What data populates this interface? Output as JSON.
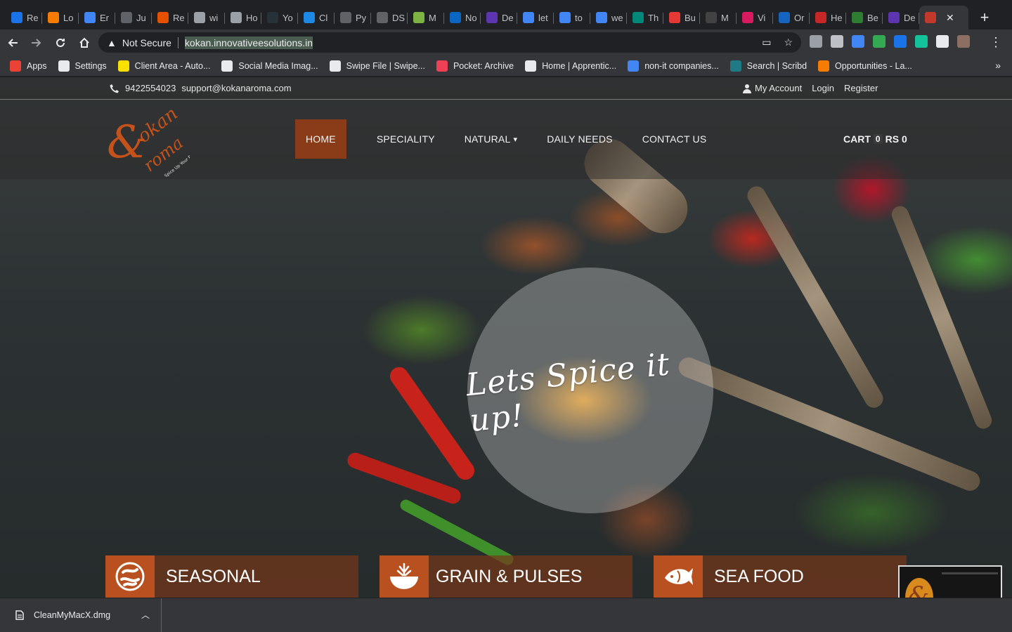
{
  "browser": {
    "tabs": [
      {
        "title": "Re",
        "color": "#1a73e8"
      },
      {
        "title": "Lo",
        "color": "#f57c00"
      },
      {
        "title": "Er",
        "color": "#4285f4"
      },
      {
        "title": "Ju",
        "color": "#5f6368"
      },
      {
        "title": "Re",
        "color": "#e65100"
      },
      {
        "title": "wi",
        "color": "#9aa0a6"
      },
      {
        "title": "Ho",
        "color": "#9aa0a6"
      },
      {
        "title": "Yo",
        "color": "#263238"
      },
      {
        "title": "Cl",
        "color": "#1e88e5"
      },
      {
        "title": "Py",
        "color": "#5f6368"
      },
      {
        "title": "DS",
        "color": "#5f6368"
      },
      {
        "title": "M",
        "color": "#7cb342"
      },
      {
        "title": "No",
        "color": "#0a66c2"
      },
      {
        "title": "De",
        "color": "#5e35b1"
      },
      {
        "title": "let",
        "color": "#4285f4"
      },
      {
        "title": "to",
        "color": "#4285f4"
      },
      {
        "title": "we",
        "color": "#4285f4"
      },
      {
        "title": "Th",
        "color": "#00897b"
      },
      {
        "title": "Bu",
        "color": "#e53935"
      },
      {
        "title": "M",
        "color": "#424242"
      },
      {
        "title": "Vi",
        "color": "#d81b60"
      },
      {
        "title": "Or",
        "color": "#1565c0"
      },
      {
        "title": "He",
        "color": "#c62828"
      },
      {
        "title": "Be",
        "color": "#2e7d32"
      },
      {
        "title": "De",
        "color": "#5e35b1"
      }
    ],
    "active_tab": {
      "title": "",
      "color": "#c0392b"
    },
    "close_glyph": "✕",
    "new_tab_glyph": "+",
    "security_label": "Not Secure",
    "url": "kokan.innovativeesolutions.in",
    "extension_colors": [
      "#9aa0a6",
      "#bdc1c6",
      "#4285f4",
      "#34a853",
      "#1a73e8",
      "#15c39a",
      "#e8eaed",
      "#8d6e63"
    ],
    "bookmarks": [
      {
        "label": "Apps",
        "icon": "apps-grid-icon",
        "color": "#ea4335"
      },
      {
        "label": "Settings",
        "icon": "gear-icon",
        "color": "#e8eaed"
      },
      {
        "label": "Client Area - Auto...",
        "icon": "w-icon",
        "color": "#f9e000"
      },
      {
        "label": "Social Media Imag...",
        "icon": "l-icon",
        "color": "#e8eaed"
      },
      {
        "label": "Swipe File | Swipe...",
        "icon": "globe-icon",
        "color": "#e8eaed"
      },
      {
        "label": "Pocket: Archive",
        "icon": "pocket-icon",
        "color": "#ef4056"
      },
      {
        "label": "Home | Apprentic...",
        "icon": "globe-icon",
        "color": "#e8eaed"
      },
      {
        "label": "non-it companies...",
        "icon": "drive-icon",
        "color": "#4285f4"
      },
      {
        "label": "Search | Scribd",
        "icon": "scribd-icon",
        "color": "#1e7b85"
      },
      {
        "label": "Opportunities - La...",
        "icon": "circle-icon",
        "color": "#f57c00"
      }
    ],
    "bookmarks_more": "»"
  },
  "site": {
    "phone": "9422554023",
    "email": "support@kokanaroma.com",
    "account_links": [
      "My Account",
      "Login",
      "Register"
    ],
    "logo_colors": {
      "primary": "#c4521a"
    },
    "nav": [
      {
        "label": "HOME",
        "active": true
      },
      {
        "label": "SPECIALITY",
        "active": false
      },
      {
        "label": "NATURAL",
        "active": false,
        "dropdown": true
      },
      {
        "label": "DAILY NEEDS",
        "active": false
      },
      {
        "label": "CONTACT US",
        "active": false
      }
    ],
    "cart": {
      "label": "CART",
      "count": "0",
      "currency": "RS",
      "total": "0"
    },
    "hero_text": "Lets Spice it up!",
    "categories": [
      {
        "label": "SEASONAL",
        "icon": "seasonal-icon"
      },
      {
        "label": "GRAIN & PULSES",
        "icon": "grain-bowl-icon"
      },
      {
        "label": "SEA FOOD",
        "icon": "fish-icon"
      }
    ],
    "accent_color": "#8a3b18"
  },
  "downloads": {
    "file_name": "CleanMyMacX.dmg"
  }
}
